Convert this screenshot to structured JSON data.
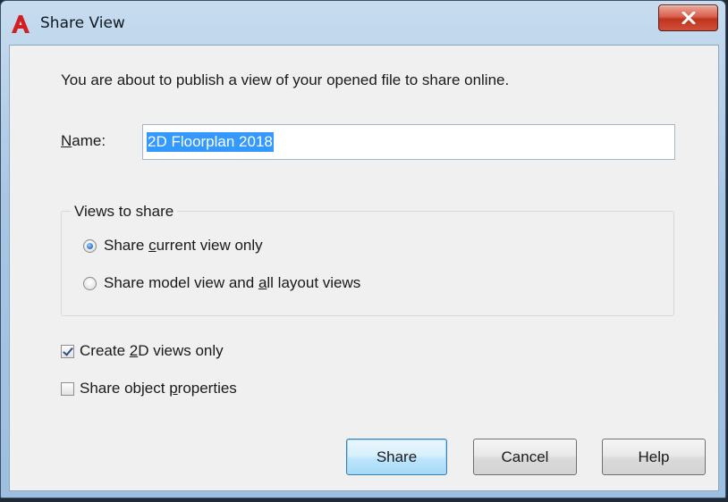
{
  "window": {
    "title": "Share View",
    "close_glyph": "x"
  },
  "icons": {
    "app": "autocad-logo-icon",
    "close": "close-icon"
  },
  "colors": {
    "accent": "#3399ff",
    "logo": "#d21f1f",
    "close_button": "#c9452f"
  },
  "intro_text": "You are about to publish a view of your opened file to share online.",
  "name_field": {
    "label_mnemonic": "N",
    "label_rest": "ame:",
    "value": "2D Floorplan 2018"
  },
  "views_group": {
    "legend": "Views to share",
    "options": [
      {
        "pre": "Share ",
        "mnemonic": "c",
        "post": "urrent view only",
        "checked": true
      },
      {
        "pre": "Share model view and ",
        "mnemonic": "a",
        "post": "ll layout views",
        "checked": false
      }
    ]
  },
  "checkboxes": [
    {
      "pre": "Create ",
      "mnemonic": "2",
      "post": "D views only",
      "checked": true
    },
    {
      "pre": "Share object ",
      "mnemonic": "p",
      "post": "roperties",
      "checked": false
    }
  ],
  "buttons": {
    "share": "Share",
    "cancel": "Cancel",
    "help": "Help"
  }
}
